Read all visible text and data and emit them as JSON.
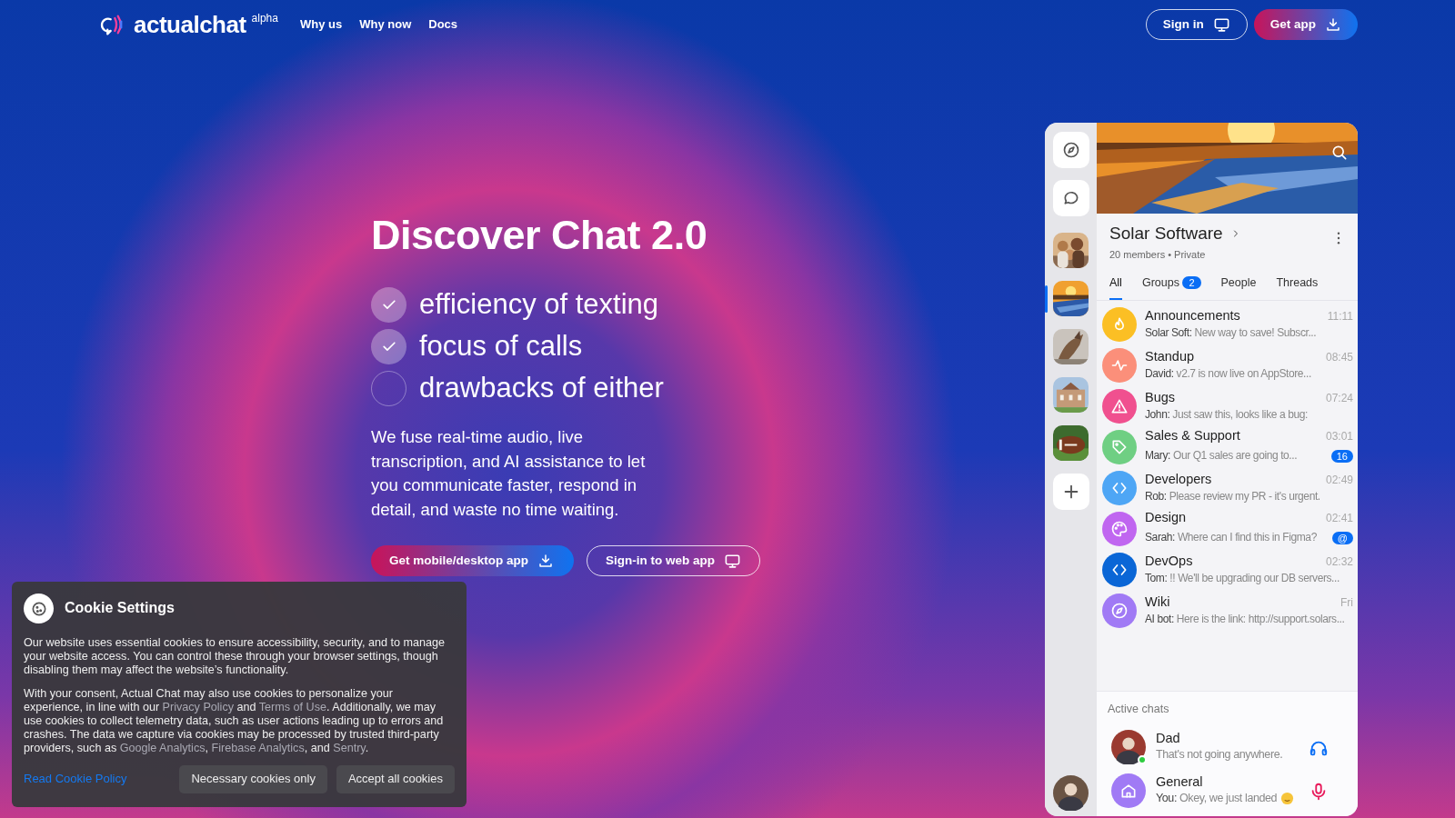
{
  "nav": {
    "brand": "actualchat",
    "tag": "alpha",
    "links": [
      "Why us",
      "Why now",
      "Docs"
    ],
    "sign_in": "Sign in",
    "get_app": "Get app"
  },
  "hero": {
    "title": "Discover Chat 2.0",
    "points": [
      {
        "text": "efficiency of texting",
        "checked": true
      },
      {
        "text": "focus of calls",
        "checked": true
      },
      {
        "text": "drawbacks of either",
        "checked": false
      }
    ],
    "description": "We fuse real-time audio, live transcription, and AI assistance to let you communicate faster, respond in detail, and waste no time waiting.",
    "primary_button": "Get mobile/desktop app",
    "secondary_button": "Sign-in to web app"
  },
  "app": {
    "sidebar": {
      "avatars": [
        {
          "selected": false
        },
        {
          "selected": true
        },
        {
          "selected": false
        },
        {
          "selected": false
        },
        {
          "selected": false
        }
      ]
    },
    "chat": {
      "title": "Solar Software",
      "subtitle": "20 members • Private"
    },
    "tabs": [
      {
        "label": "All",
        "selected": true
      },
      {
        "label": "Groups",
        "selected": false,
        "badge": "2"
      },
      {
        "label": "People",
        "selected": false
      },
      {
        "label": "Threads",
        "selected": false
      }
    ],
    "chats": [
      {
        "name": "Announcements",
        "time": "11:11",
        "sender": "Solar Soft:",
        "text": "New way to save! Subscr...",
        "kind": "flame",
        "color": "#fbbf24"
      },
      {
        "name": "Standup",
        "time": "08:45",
        "sender": "David:",
        "text": "v2.7 is now live on AppStore...",
        "kind": "pulse",
        "color": "#fb8f7a"
      },
      {
        "name": "Bugs",
        "time": "07:24",
        "sender": "John:",
        "text": "Just saw this, looks like a bug:",
        "kind": "warning",
        "color": "#f0508f"
      },
      {
        "name": "Sales & Support",
        "time": "03:01",
        "sender": "Mary:",
        "text": "Our Q1 sales are going to...",
        "kind": "tag",
        "color": "#6fcf83",
        "badge": "16"
      },
      {
        "name": "Developers",
        "time": "02:49",
        "sender": "Rob:",
        "text": "Please review my PR - it's urgent.",
        "kind": "code",
        "color": "#4ea6f5"
      },
      {
        "name": "Design",
        "time": "02:41",
        "sender": "Sarah:",
        "text": "Where can I find this in Figma?",
        "kind": "palette",
        "color": "#c066f0",
        "badge": "@"
      },
      {
        "name": "DevOps",
        "time": "02:32",
        "sender": "Tom:",
        "text": "!! We'll be upgrading our DB servers...",
        "kind": "code",
        "color": "#0a66d6"
      },
      {
        "name": "Wiki",
        "time": "Fri",
        "sender": "AI bot:",
        "text": "Here is the link: http://support.solars...",
        "kind": "compass",
        "color": "#a07af5"
      }
    ],
    "active_chats": {
      "title": "Active chats",
      "items": [
        {
          "name": "Dad",
          "text": "That's not going anywhere.",
          "group": false,
          "online": true,
          "kind": "headphones",
          "emoji": false
        },
        {
          "name": "General",
          "sender": "You:",
          "text": "Okey, we just landed",
          "group": true,
          "online": false,
          "kind": "microphone",
          "emoji": true
        }
      ]
    }
  },
  "cookie": {
    "title": "Cookie Settings",
    "paragraphs": [
      [
        {
          "text": "Our website uses essential cookies to ensure accessibility, security, and to manage your website access. You can control these through your browser settings, though disabling them may affect the website’s functionality.",
          "link": false
        }
      ],
      [
        {
          "text": "With your consent, Actual Chat may also use cookies to personalize your experience, in line with our ",
          "link": false
        },
        {
          "text": "Privacy Policy",
          "link": true
        },
        {
          "text": " and ",
          "link": false
        },
        {
          "text": "Terms of Use",
          "link": true
        },
        {
          "text": ". Additionally, we may use cookies to collect telemetry data, such as user actions leading up to errors and crashes. The data we capture via cookies may be processed by trusted third-party providers, such as ",
          "link": false
        },
        {
          "text": "Google Analytics",
          "link": true
        },
        {
          "text": ", ",
          "link": false
        },
        {
          "text": "Firebase Analytics",
          "link": true
        },
        {
          "text": ", and ",
          "link": false
        },
        {
          "text": "Sentry",
          "link": true
        },
        {
          "text": ".",
          "link": false
        }
      ]
    ],
    "policy_link": "Read Cookie Policy",
    "buttons": [
      "Necessary cookies only",
      "Accept all cookies"
    ]
  }
}
